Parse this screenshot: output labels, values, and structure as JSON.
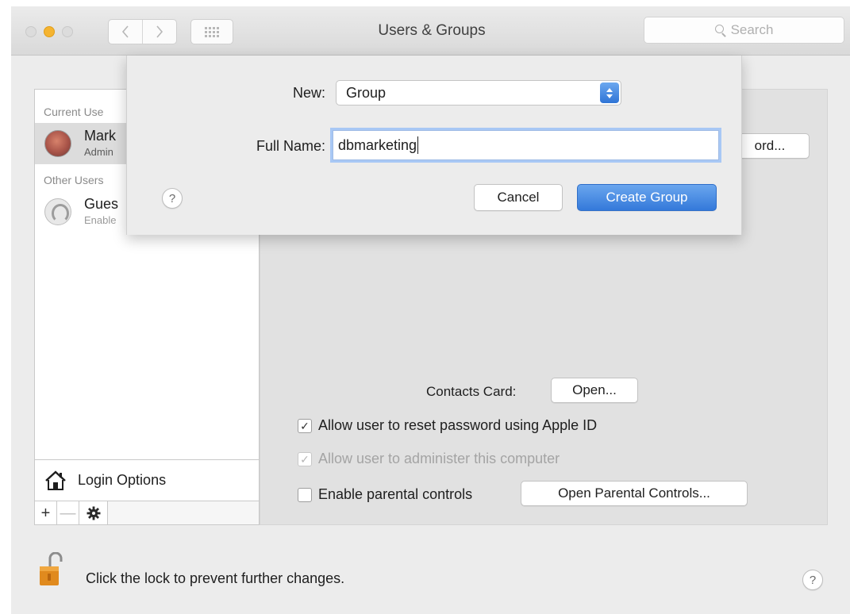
{
  "window": {
    "title": "Users & Groups",
    "search_placeholder": "Search"
  },
  "sidebar": {
    "current_users_label": "Current Use",
    "current_user": {
      "name": "Mark",
      "role": "Admin"
    },
    "other_users_label": "Other Users",
    "guest_user": {
      "name": "Gues",
      "status": "Enable"
    },
    "login_options_label": "Login Options",
    "add_label": "+",
    "remove_label": "—"
  },
  "panel": {
    "password_button_label": "ord...",
    "contacts_card_label": "Contacts Card:",
    "open_button_label": "Open...",
    "checkbox_reset": {
      "label": "Allow user to reset password using Apple ID",
      "checked": true
    },
    "checkbox_admin": {
      "label": "Allow user to administer this computer",
      "checked": true,
      "disabled": true
    },
    "checkbox_parental": {
      "label": "Enable parental controls",
      "checked": false
    },
    "parental_button_label": "Open Parental Controls..."
  },
  "sheet": {
    "new_label": "New:",
    "new_value": "Group",
    "fullname_label": "Full Name:",
    "fullname_value": "dbmarketing",
    "help_label": "?",
    "cancel_label": "Cancel",
    "create_label": "Create Group"
  },
  "footer": {
    "lock_text": "Click the lock to prevent further changes.",
    "help_label": "?"
  },
  "colors": {
    "accent": "#3479da",
    "minimize": "#f5b431",
    "lock": "#e08a1e"
  },
  "icons": [
    "chevron-left-icon",
    "chevron-right-icon",
    "grid-icon",
    "search-icon",
    "house-icon",
    "gear-icon",
    "lock-icon",
    "help-icon"
  ]
}
